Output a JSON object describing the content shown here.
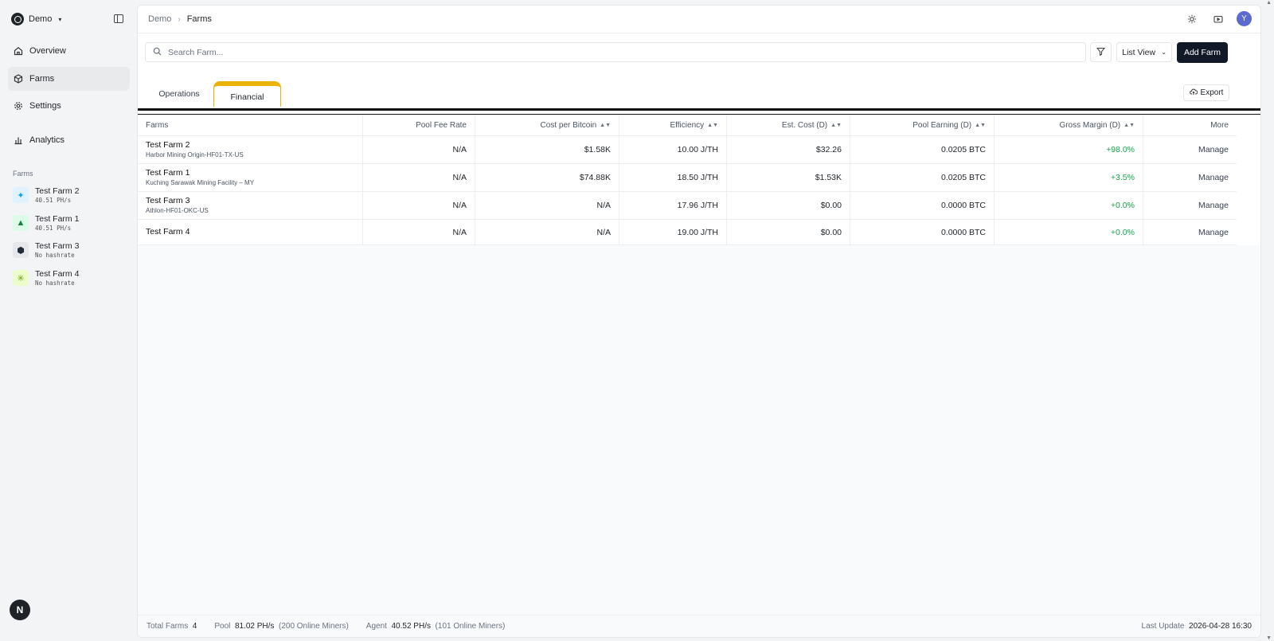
{
  "workspace": {
    "name": "Demo"
  },
  "nav": [
    {
      "label": "Overview"
    },
    {
      "label": "Farms"
    },
    {
      "label": "Settings"
    },
    {
      "label": "Analytics"
    }
  ],
  "sidebar_farms": {
    "section_label": "Farms",
    "items": [
      {
        "name": "Test Farm 2",
        "sub": "40.51 PH/s",
        "icon": "blue-sparkle-icon",
        "color": "#0ea5e9"
      },
      {
        "name": "Test Farm 1",
        "sub": "40.51 PH/s",
        "icon": "green-tree-icon",
        "color": "#15803d"
      },
      {
        "name": "Test Farm 3",
        "sub": "No hashrate",
        "icon": "dark-blob-icon",
        "color": "#1f2937"
      },
      {
        "name": "Test Farm 4",
        "sub": "No hashrate",
        "icon": "lime-star-icon",
        "color": "#84cc16"
      }
    ]
  },
  "n_badge": "N",
  "breadcrumb": {
    "parent": "Demo",
    "current": "Farms"
  },
  "user": {
    "initial": "Y"
  },
  "search": {
    "placeholder": "Search Farm..."
  },
  "toolbar": {
    "view_label": "List View",
    "add_label": "Add Farm"
  },
  "tabs": [
    {
      "label": "Operations"
    },
    {
      "label": "Financial"
    }
  ],
  "export_label": "Export",
  "table": {
    "headers": {
      "farms": "Farms",
      "pool_fee": "Pool Fee Rate",
      "cost_per_btc": "Cost per Bitcoin",
      "efficiency": "Efficiency",
      "est_cost": "Est. Cost (D)",
      "pool_earning": "Pool Earning (D)",
      "gross_margin": "Gross Margin (D)",
      "more": "More"
    },
    "rows": [
      {
        "name": "Test Farm 2",
        "location": "Harbor Mining Origin-HF01-TX-US",
        "pool_fee": "N/A",
        "cost_per_btc": "$1.58K",
        "efficiency": "10.00 J/TH",
        "est_cost": "$32.26",
        "pool_earning": "0.0205 BTC",
        "gross_margin": "+98.0%",
        "action": "Manage"
      },
      {
        "name": "Test Farm 1",
        "location": "Kuching Sarawak Mining Facility – MY",
        "pool_fee": "N/A",
        "cost_per_btc": "$74.88K",
        "efficiency": "18.50 J/TH",
        "est_cost": "$1.53K",
        "pool_earning": "0.0205 BTC",
        "gross_margin": "+3.5%",
        "action": "Manage"
      },
      {
        "name": "Test Farm 3",
        "location": "Athlon-HF01-OKC-US",
        "pool_fee": "N/A",
        "cost_per_btc": "N/A",
        "efficiency": "17.96 J/TH",
        "est_cost": "$0.00",
        "pool_earning": "0.0000 BTC",
        "gross_margin": "+0.0%",
        "action": "Manage"
      },
      {
        "name": "Test Farm 4",
        "location": "",
        "pool_fee": "N/A",
        "cost_per_btc": "N/A",
        "efficiency": "19.00 J/TH",
        "est_cost": "$0.00",
        "pool_earning": "0.0000 BTC",
        "gross_margin": "+0.0%",
        "action": "Manage"
      }
    ]
  },
  "footer": {
    "total_label": "Total Farms",
    "total_value": "4",
    "pool_label": "Pool",
    "pool_value": "81.02 PH/s",
    "pool_miners": "(200 Online Miners)",
    "agent_label": "Agent",
    "agent_value": "40.52 PH/s",
    "agent_miners": "(101 Online Miners)",
    "update_label": "Last Update",
    "update_value": "2026-04-28 16:30"
  },
  "colors": {
    "accent_tab": "#eab308",
    "positive": "#16a34a",
    "primary_button": "#111827",
    "avatar": "#5b6ad0"
  }
}
